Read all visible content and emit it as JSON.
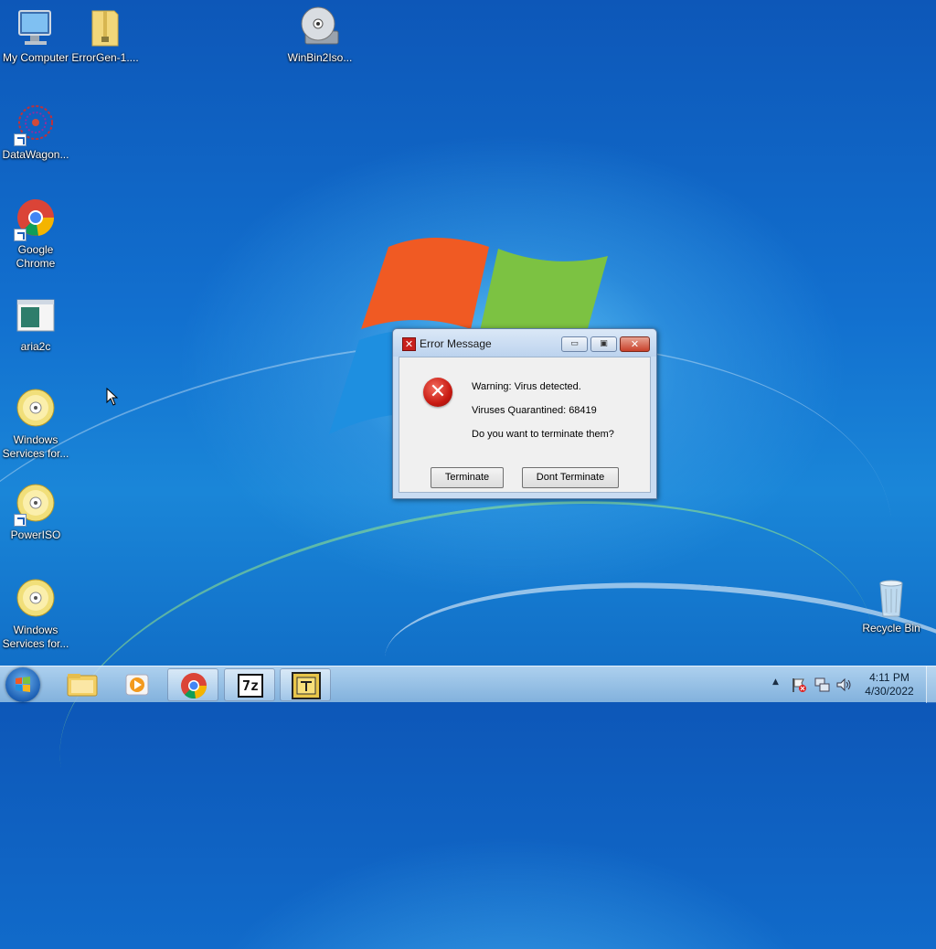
{
  "desktop": {
    "icons": [
      {
        "label": "My Computer",
        "icon": "computer-icon"
      },
      {
        "label": "ErrorGen-1....",
        "icon": "zip-folder-icon"
      },
      {
        "label": "WinBin2Iso...",
        "icon": "disc-icon"
      },
      {
        "label": "DataWagon...",
        "icon": "datawagon-icon"
      },
      {
        "label": "Google Chrome",
        "icon": "chrome-icon"
      },
      {
        "label": "aria2c",
        "icon": "application-window-icon"
      },
      {
        "label": "Windows Services for...",
        "icon": "disc-icon"
      },
      {
        "label": "PowerISO",
        "icon": "disc-icon"
      },
      {
        "label": "Windows Services for...",
        "icon": "disc-icon"
      },
      {
        "label": "Recycle Bin",
        "icon": "recycle-bin-icon"
      }
    ]
  },
  "dialog": {
    "title": "Error Message",
    "lines": [
      "Warning: Virus detected.",
      "Viruses Quarantined: 68419",
      "Do you want to terminate them?"
    ],
    "buttons": {
      "terminate": "Terminate",
      "dont_terminate": "Dont Terminate"
    },
    "error_icon_glyph": "✕",
    "titlebar_buttons": {
      "minimize": "▭",
      "maximize": "▣",
      "close": "✕"
    }
  },
  "taskbar": {
    "pinned": [
      "file-explorer-icon",
      "media-player-icon",
      "chrome-icon",
      "7zip-icon",
      "errorgen-icon"
    ],
    "sevenzip_label": "7z",
    "tray_arrow": "▲",
    "clock": {
      "time": "4:11 PM",
      "date": "4/30/2022"
    }
  },
  "colors": {
    "accent_red": "#c8201d",
    "taskbar": "#a8c9e6"
  }
}
